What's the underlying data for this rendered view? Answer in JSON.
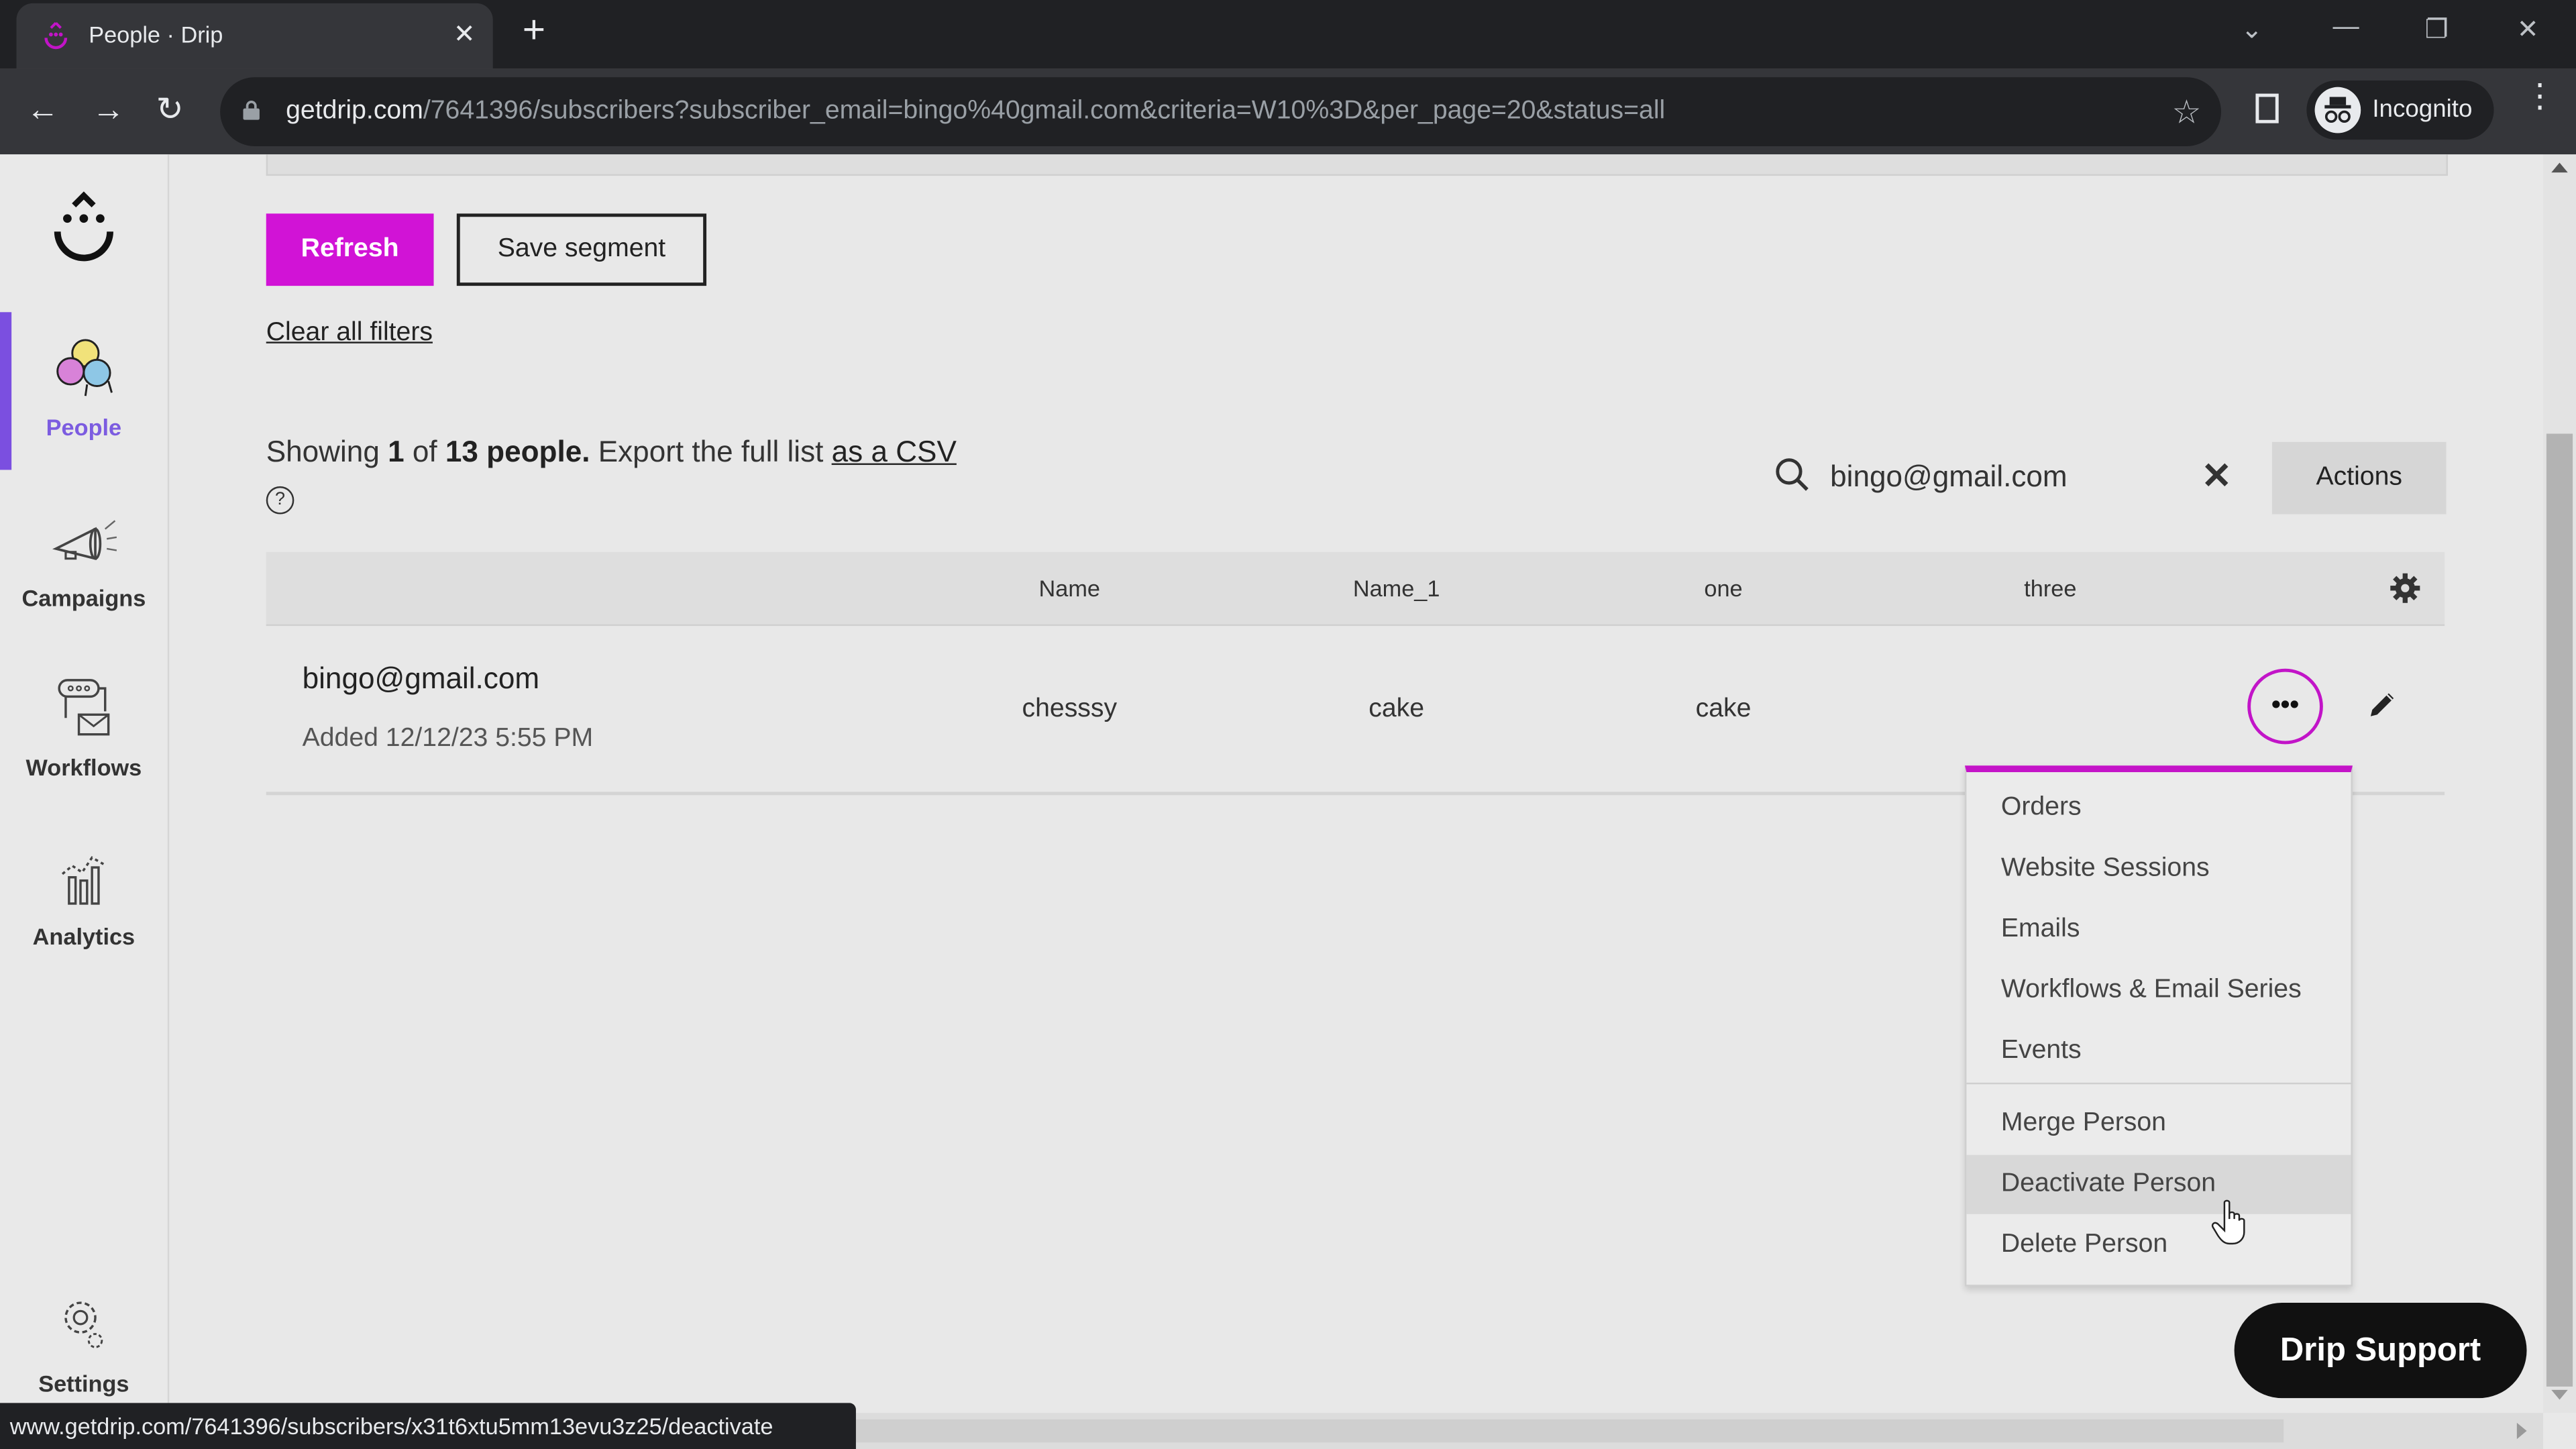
{
  "browser": {
    "tab_title": "People · Drip",
    "url_host": "getdrip.com",
    "url_path": "/7641396/subscribers?subscriber_email=bingo%40gmail.com&criteria=W10%3D&per_page=20&status=all",
    "profile_label": "Incognito",
    "status_url": "www.getdrip.com/7641396/subscribers/x31t6xtu5mm13evu3z25/deactivate"
  },
  "sidebar": {
    "items": [
      {
        "label": "People",
        "icon": "people-icon",
        "active": true
      },
      {
        "label": "Campaigns",
        "icon": "megaphone-icon"
      },
      {
        "label": "Workflows",
        "icon": "workflow-icon"
      },
      {
        "label": "Analytics",
        "icon": "analytics-icon"
      },
      {
        "label": "Settings",
        "icon": "gear-icon"
      }
    ]
  },
  "toolbar": {
    "refresh_label": "Refresh",
    "save_segment_label": "Save segment",
    "clear_filters_label": "Clear all filters"
  },
  "summary": {
    "prefix": "Showing ",
    "shown": "1",
    "of": " of ",
    "total": "13 people.",
    "export_text": " Export the full list ",
    "csv_link": "as a CSV",
    "help_glyph": "?"
  },
  "search": {
    "value": "bingo@gmail.com",
    "actions_label": "Actions"
  },
  "table": {
    "columns": [
      "Name",
      "Name_1",
      "one",
      "three"
    ],
    "rows": [
      {
        "email": "bingo@gmail.com",
        "added": "Added 12/12/23 5:55 PM",
        "cells": [
          "chesssy",
          "cake",
          "cake",
          ""
        ]
      }
    ],
    "more_glyph": "•••"
  },
  "row_menu": {
    "items": [
      "Orders",
      "Website Sessions",
      "Emails",
      "Workflows & Email Series",
      "Events",
      "Merge Person",
      "Deactivate Person",
      "Delete Person"
    ],
    "hovered": "Deactivate Person"
  },
  "support_label": "Drip Support",
  "colors": {
    "brand_magenta": "#d113d6",
    "active_nav": "#7b4fe0"
  }
}
